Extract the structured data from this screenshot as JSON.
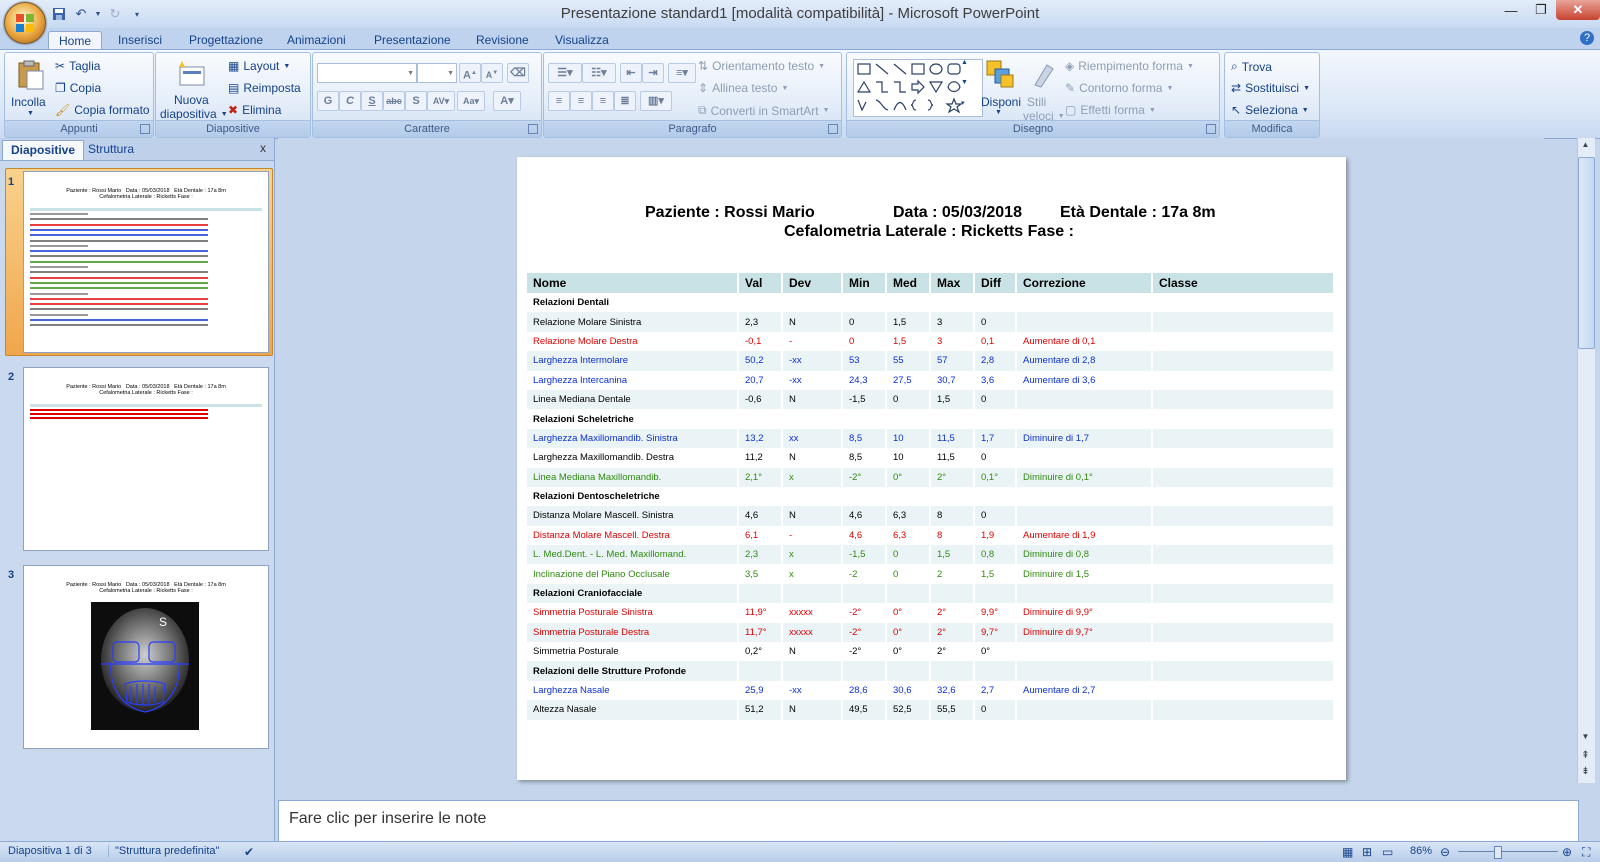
{
  "window": {
    "title": "Presentazione standard1 [modalità compatibilità] - Microsoft PowerPoint"
  },
  "tabs": [
    "Home",
    "Inserisci",
    "Progettazione",
    "Animazioni",
    "Presentazione",
    "Revisione",
    "Visualizza"
  ],
  "ribbon": {
    "appunti": {
      "label": "Appunti",
      "incolla": "Incolla",
      "taglia": "Taglia",
      "copia": "Copia",
      "copia_formato": "Copia formato"
    },
    "diapositive": {
      "label": "Diapositive",
      "nuova_1": "Nuova",
      "nuova_2": "diapositiva",
      "layout": "Layout",
      "reimposta": "Reimposta",
      "elimina": "Elimina"
    },
    "carattere": {
      "label": "Carattere"
    },
    "paragrafo": {
      "label": "Paragrafo",
      "orientamento": "Orientamento testo",
      "allinea": "Allinea testo",
      "converti": "Converti in SmartArt"
    },
    "disegno": {
      "label": "Disegno",
      "disponi": "Disponi",
      "stili_1": "Stili",
      "stili_2": "veloci",
      "riempimento": "Riempimento forma",
      "contorno": "Contorno forma",
      "effetti": "Effetti forma"
    },
    "modifica": {
      "label": "Modifica",
      "trova": "Trova",
      "sostituisci": "Sostituisci",
      "seleziona": "Seleziona"
    }
  },
  "leftpane": {
    "tab_diapositive": "Diapositive",
    "tab_struttura": "Struttura",
    "close": "x",
    "slide_numbers": [
      "1",
      "2",
      "3"
    ]
  },
  "slide": {
    "header_line1_a": "Paziente : Rossi Mario",
    "header_line1_b": "Data : 05/03/2018",
    "header_line1_c": "Età Dentale : 17a 8m",
    "header_line2": "Cefalometria Laterale : Ricketts  Fase :",
    "columns": [
      "Nome",
      "Val",
      "Dev",
      "Min",
      "Med",
      "Max",
      "Diff",
      "Correzione",
      "Classe"
    ],
    "rows": [
      {
        "type": "section",
        "color": "black",
        "cells": [
          "Relazioni Dentali",
          "",
          "",
          "",
          "",
          "",
          "",
          "",
          ""
        ]
      },
      {
        "type": "row",
        "color": "black",
        "cells": [
          "Relazione Molare Sinistra",
          "2,3",
          "N",
          "0",
          "1,5",
          "3",
          "0",
          "",
          ""
        ]
      },
      {
        "type": "row",
        "color": "red",
        "cells": [
          "Relazione Molare Destra",
          "-0,1",
          "-",
          "0",
          "1,5",
          "3",
          "0,1",
          "Aumentare di 0,1",
          ""
        ]
      },
      {
        "type": "row",
        "color": "blue",
        "cells": [
          "Larghezza  Intermolare",
          "50,2",
          "-xx",
          "53",
          "55",
          "57",
          "2,8",
          "Aumentare di 2,8",
          ""
        ]
      },
      {
        "type": "row",
        "color": "blue",
        "cells": [
          "Larghezza  Intercanina",
          "20,7",
          "-xx",
          "24,3",
          "27,5",
          "30,7",
          "3,6",
          "Aumentare di 3,6",
          ""
        ]
      },
      {
        "type": "row",
        "color": "black",
        "cells": [
          "Linea Mediana  Dentale",
          "-0,6",
          "N",
          "-1,5",
          "0",
          "1,5",
          "0",
          "",
          ""
        ]
      },
      {
        "type": "section",
        "color": "black",
        "cells": [
          "Relazioni Scheletriche",
          "",
          "",
          "",
          "",
          "",
          "",
          "",
          ""
        ]
      },
      {
        "type": "row",
        "color": "blue",
        "cells": [
          "Larghezza  Maxillomandib. Sinistra",
          "13,2",
          "xx",
          "8,5",
          "10",
          "11,5",
          "1,7",
          "Diminuire di 1,7",
          ""
        ]
      },
      {
        "type": "row",
        "color": "black",
        "cells": [
          "Larghezza  Maxillomandib. Destra",
          "11,2",
          "N",
          "8,5",
          "10",
          "11,5",
          "0",
          "",
          ""
        ]
      },
      {
        "type": "row",
        "color": "green",
        "cells": [
          "Linea Mediana  Maxillomandib.",
          "2,1°",
          "x",
          "-2°",
          "0°",
          "2°",
          "0,1°",
          "Diminuire di 0,1°",
          ""
        ]
      },
      {
        "type": "section",
        "color": "black",
        "cells": [
          "Relazioni Dentoscheletriche",
          "",
          "",
          "",
          "",
          "",
          "",
          "",
          ""
        ]
      },
      {
        "type": "row",
        "color": "black",
        "cells": [
          "Distanza Molare Mascell. Sinistra",
          "4,6",
          "N",
          "4,6",
          "6,3",
          "8",
          "0",
          "",
          ""
        ]
      },
      {
        "type": "row",
        "color": "red",
        "cells": [
          "Distanza Molare Mascell. Destra",
          "6,1",
          "-",
          "4,6",
          "6,3",
          "8",
          "1,9",
          "Aumentare di 1,9",
          ""
        ]
      },
      {
        "type": "row",
        "color": "green",
        "cells": [
          "L. Med.Dent. - L. Med. Maxillomand.",
          "2,3",
          "x",
          "-1,5",
          "0",
          "1,5",
          "0,8",
          "Diminuire di 0,8",
          ""
        ]
      },
      {
        "type": "row",
        "color": "green",
        "cells": [
          "Inclinazione del Piano Occlusale",
          "3,5",
          "x",
          "-2",
          "0",
          "2",
          "1,5",
          "Diminuire di 1,5",
          ""
        ]
      },
      {
        "type": "section",
        "color": "black",
        "cells": [
          "Relazioni Craniofacciale",
          "",
          "",
          "",
          "",
          "",
          "",
          "",
          ""
        ]
      },
      {
        "type": "row",
        "color": "red",
        "cells": [
          "Simmetria Posturale Sinistra",
          "11,9°",
          "xxxxx",
          "-2°",
          "0°",
          "2°",
          "9,9°",
          "Diminuire di 9,9°",
          ""
        ]
      },
      {
        "type": "row",
        "color": "red",
        "cells": [
          "Simmetria Posturale Destra",
          "11,7°",
          "xxxxx",
          "-2°",
          "0°",
          "2°",
          "9,7°",
          "Diminuire di 9,7°",
          ""
        ]
      },
      {
        "type": "row",
        "color": "black",
        "cells": [
          "Simmetria Posturale",
          "0,2°",
          "N",
          "-2°",
          "0°",
          "2°",
          "0°",
          "",
          ""
        ]
      },
      {
        "type": "section",
        "color": "black",
        "cells": [
          "Relazioni delle Strutture Profonde",
          "",
          "",
          "",
          "",
          "",
          "",
          "",
          ""
        ]
      },
      {
        "type": "row",
        "color": "blue",
        "cells": [
          "Larghezza  Nasale",
          "25,9",
          "-xx",
          "28,6",
          "30,6",
          "32,6",
          "2,7",
          "Aumentare di 2,7",
          ""
        ]
      },
      {
        "type": "row",
        "color": "black",
        "cells": [
          "Altezza Nasale",
          "51,2",
          "N",
          "49,5",
          "52,5",
          "55,5",
          "0",
          "",
          ""
        ]
      }
    ]
  },
  "notes": {
    "placeholder": "Fare clic per inserire le note"
  },
  "status": {
    "slide_info": "Diapositiva 1 di 3",
    "theme": "\"Struttura predefinita\"",
    "zoom": "86%"
  },
  "colors": {
    "red": "#e00000",
    "blue": "#0b2fd0",
    "green": "#2e8b0e",
    "header_bg": "#c9e2e6",
    "row_alt": "#eaf4f6"
  }
}
